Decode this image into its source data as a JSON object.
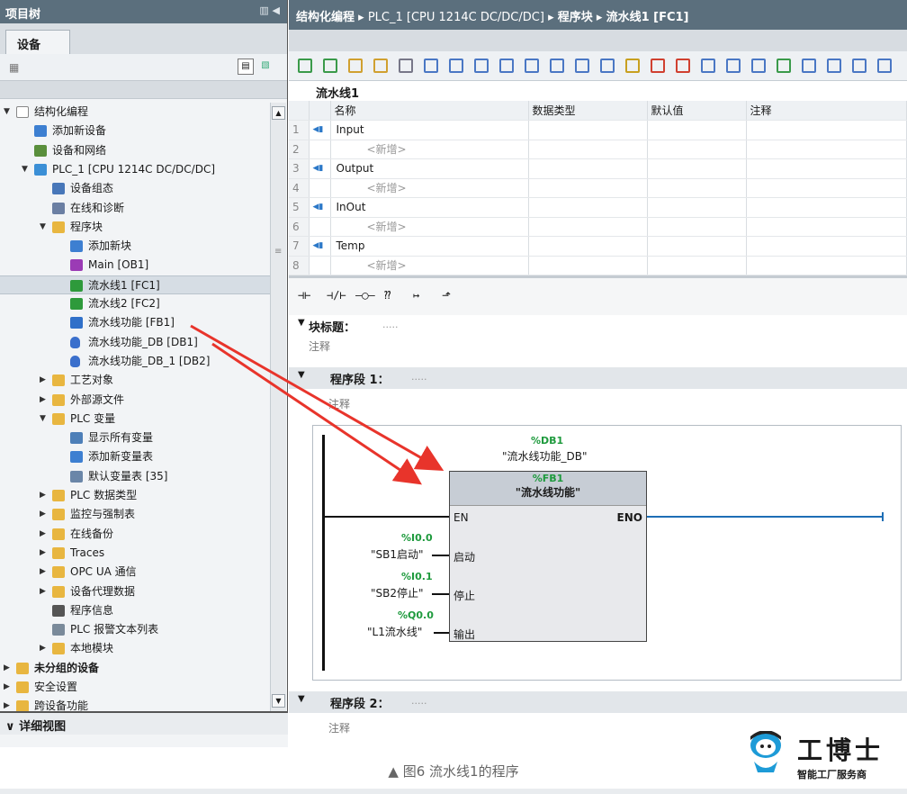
{
  "left_panel": {
    "title": "项目树",
    "tab": "设备",
    "tree": [
      {
        "label": "结构化编程",
        "depth": 0,
        "toggle": "▼",
        "icon": "doc-icon",
        "bold": false
      },
      {
        "label": "添加新设备",
        "depth": 1,
        "toggle": "",
        "icon": "add-device-icon"
      },
      {
        "label": "设备和网络",
        "depth": 1,
        "toggle": "",
        "icon": "network-icon"
      },
      {
        "label": "PLC_1 [CPU 1214C DC/DC/DC]",
        "depth": 1,
        "toggle": "▼",
        "icon": "plc-icon"
      },
      {
        "label": "设备组态",
        "depth": 2,
        "toggle": "",
        "icon": "config-icon"
      },
      {
        "label": "在线和诊断",
        "depth": 2,
        "toggle": "",
        "icon": "diagnostics-icon"
      },
      {
        "label": "程序块",
        "depth": 2,
        "toggle": "▼",
        "icon": "folder-icon"
      },
      {
        "label": "添加新块",
        "depth": 3,
        "toggle": "",
        "icon": "add-block-icon"
      },
      {
        "label": "Main [OB1]",
        "depth": 3,
        "toggle": "",
        "icon": "ob-icon"
      },
      {
        "label": "流水线1 [FC1]",
        "depth": 3,
        "toggle": "",
        "icon": "fc-icon",
        "selected": true
      },
      {
        "label": "流水线2 [FC2]",
        "depth": 3,
        "toggle": "",
        "icon": "fc-icon"
      },
      {
        "label": "流水线功能 [FB1]",
        "depth": 3,
        "toggle": "",
        "icon": "fb-icon"
      },
      {
        "label": "流水线功能_DB [DB1]",
        "depth": 3,
        "toggle": "",
        "icon": "db-icon"
      },
      {
        "label": "流水线功能_DB_1 [DB2]",
        "depth": 3,
        "toggle": "",
        "icon": "db-icon"
      },
      {
        "label": "工艺对象",
        "depth": 2,
        "toggle": "▶",
        "icon": "folder-icon"
      },
      {
        "label": "外部源文件",
        "depth": 2,
        "toggle": "▶",
        "icon": "folder-icon"
      },
      {
        "label": "PLC 变量",
        "depth": 2,
        "toggle": "▼",
        "icon": "folder-icon"
      },
      {
        "label": "显示所有变量",
        "depth": 3,
        "toggle": "",
        "icon": "tags-icon"
      },
      {
        "label": "添加新变量表",
        "depth": 3,
        "toggle": "",
        "icon": "add-table-icon"
      },
      {
        "label": "默认变量表 [35]",
        "depth": 3,
        "toggle": "",
        "icon": "table-icon"
      },
      {
        "label": "PLC 数据类型",
        "depth": 2,
        "toggle": "▶",
        "icon": "folder-icon"
      },
      {
        "label": "监控与强制表",
        "depth": 2,
        "toggle": "▶",
        "icon": "folder-icon"
      },
      {
        "label": "在线备份",
        "depth": 2,
        "toggle": "▶",
        "icon": "folder-icon"
      },
      {
        "label": "Traces",
        "depth": 2,
        "toggle": "▶",
        "icon": "folder-icon"
      },
      {
        "label": "OPC UA 通信",
        "depth": 2,
        "toggle": "▶",
        "icon": "folder-icon"
      },
      {
        "label": "设备代理数据",
        "depth": 2,
        "toggle": "▶",
        "icon": "folder-icon"
      },
      {
        "label": "程序信息",
        "depth": 2,
        "toggle": "",
        "icon": "info-icon"
      },
      {
        "label": "PLC 报警文本列表",
        "depth": 2,
        "toggle": "",
        "icon": "list-icon"
      },
      {
        "label": "本地模块",
        "depth": 2,
        "toggle": "▶",
        "icon": "folder-icon"
      },
      {
        "label": "未分组的设备",
        "depth": 0,
        "toggle": "▶",
        "icon": "folder-icon",
        "bold": true
      },
      {
        "label": "安全设置",
        "depth": 0,
        "toggle": "▶",
        "icon": "folder-icon"
      },
      {
        "label": "跨设备功能",
        "depth": 0,
        "toggle": "▶",
        "icon": "folder-icon"
      }
    ],
    "detail_view": "详细视图"
  },
  "breadcrumb": {
    "project": "结构化编程",
    "sep": "▸",
    "device": "PLC_1 [CPU 1214C DC/DC/DC]",
    "folder": "程序块",
    "block": "流水线1 [FC1]"
  },
  "block_name": "流水线1",
  "interface": {
    "headers": [
      "名称",
      "数据类型",
      "默认值",
      "注释"
    ],
    "rows": [
      {
        "n": "1",
        "name": "Input",
        "kind": "section"
      },
      {
        "n": "2",
        "name": "<新增>",
        "kind": "add"
      },
      {
        "n": "3",
        "name": "Output",
        "kind": "section"
      },
      {
        "n": "4",
        "name": "<新增>",
        "kind": "add"
      },
      {
        "n": "5",
        "name": "InOut",
        "kind": "section"
      },
      {
        "n": "6",
        "name": "<新增>",
        "kind": "add"
      },
      {
        "n": "7",
        "name": "Temp",
        "kind": "section"
      },
      {
        "n": "8",
        "name": "<新增>",
        "kind": "add"
      }
    ]
  },
  "ladder_toolbar": [
    "⊣⊢",
    "⊣/⊢",
    "–◯–",
    "⁇",
    "↦",
    "⬏"
  ],
  "block_title": {
    "label": "块标题：",
    "dots": "....."
  },
  "block_comment": "注释",
  "network1": {
    "label": "程序段 1：",
    "dots": ".....",
    "comment": "注释",
    "db_addr": "%DB1",
    "db_name": "\"流水线功能_DB\"",
    "fb_addr": "%FB1",
    "fb_name": "\"流水线功能\"",
    "en": "EN",
    "eno": "ENO",
    "inputs": [
      {
        "addr": "%I0.0",
        "tag": "\"SB1启动\"",
        "pin": "启动"
      },
      {
        "addr": "%I0.1",
        "tag": "\"SB2停止\"",
        "pin": "停止"
      },
      {
        "addr": "%Q0.0",
        "tag": "\"L1流水线\"",
        "pin": "输出"
      }
    ]
  },
  "network2": {
    "label": "程序段 2：",
    "dots": ".....",
    "comment": "注释"
  },
  "caption": "▲ 图6 流水线1的程序",
  "logo": {
    "brand": "工博士",
    "sub": "智能工厂服务商"
  },
  "colors": {
    "title_bar": "#5b6f7d",
    "address_green": "#1e9a3d",
    "arrow_red": "#e8342b"
  }
}
